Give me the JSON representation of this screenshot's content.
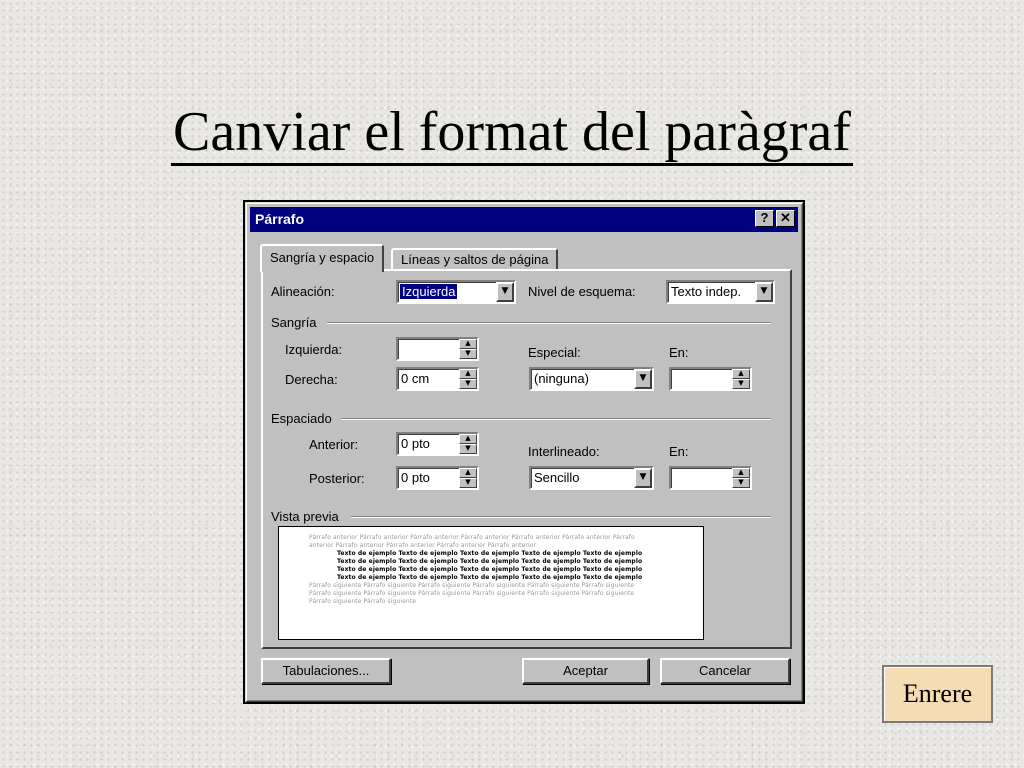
{
  "slide": {
    "title": "Canviar el format del paràgraf",
    "nav_button": "Enrere"
  },
  "dialog": {
    "title": "Párrafo",
    "help_button": "?",
    "close_button": "✕",
    "tabs": [
      {
        "label": "Sangría y espacio",
        "active": true
      },
      {
        "label": "Líneas y saltos de página",
        "active": false
      }
    ],
    "alignment": {
      "label": "Alineación:",
      "value": "Izquierda"
    },
    "outline_level": {
      "label": "Nivel de esquema:",
      "value": "Texto indep."
    },
    "indent": {
      "group_label": "Sangría",
      "left": {
        "label": "Izquierda:",
        "value": ""
      },
      "right": {
        "label": "Derecha:",
        "value": "0 cm"
      },
      "special": {
        "label": "Especial:",
        "value": "(ninguna)"
      },
      "by": {
        "label": "En:",
        "value": ""
      }
    },
    "spacing": {
      "group_label": "Espaciado",
      "before": {
        "label": "Anterior:",
        "value": "0 pto"
      },
      "after": {
        "label": "Posterior:",
        "value": "0 pto"
      },
      "line_spacing": {
        "label": "Interlineado:",
        "value": "Sencillo"
      },
      "at": {
        "label": "En:",
        "value": ""
      }
    },
    "preview": {
      "group_label": "Vista previa",
      "prev_lines": [
        "Párrafo anterior Párrafo anterior Párrafo anterior Párrafo anterior Párrafo anterior Párrafo anterior Párrafo",
        "anterior Párrafo anterior Párrafo anterior Párrafo anterior Párrafo anterior"
      ],
      "sample_lines": [
        "Texto de ejemplo Texto de ejemplo Texto de ejemplo Texto de ejemplo Texto de ejemplo",
        "Texto de ejemplo Texto de ejemplo Texto de ejemplo Texto de ejemplo Texto de ejemplo",
        "Texto de ejemplo Texto de ejemplo Texto de ejemplo Texto de ejemplo Texto de ejemplo",
        "Texto de ejemplo Texto de ejemplo Texto de ejemplo Texto de ejemplo Texto de ejemplo"
      ],
      "next_lines": [
        "Párrafo siguiente Párrafo siguiente Párrafo siguiente Párrafo siguiente Párrafo siguiente Párrafo siguiente",
        "Párrafo siguiente Párrafo siguiente Párrafo siguiente Párrafo siguiente Párrafo siguiente Párrafo siguiente",
        "Párrafo siguiente Párrafo siguiente"
      ]
    },
    "buttons": {
      "tabs": "Tabulaciones...",
      "ok": "Aceptar",
      "cancel": "Cancelar"
    }
  },
  "colors": {
    "titlebar": "#000080",
    "dialog_face": "#c0c0c0",
    "nav_button_bg": "#f6dcb3"
  }
}
